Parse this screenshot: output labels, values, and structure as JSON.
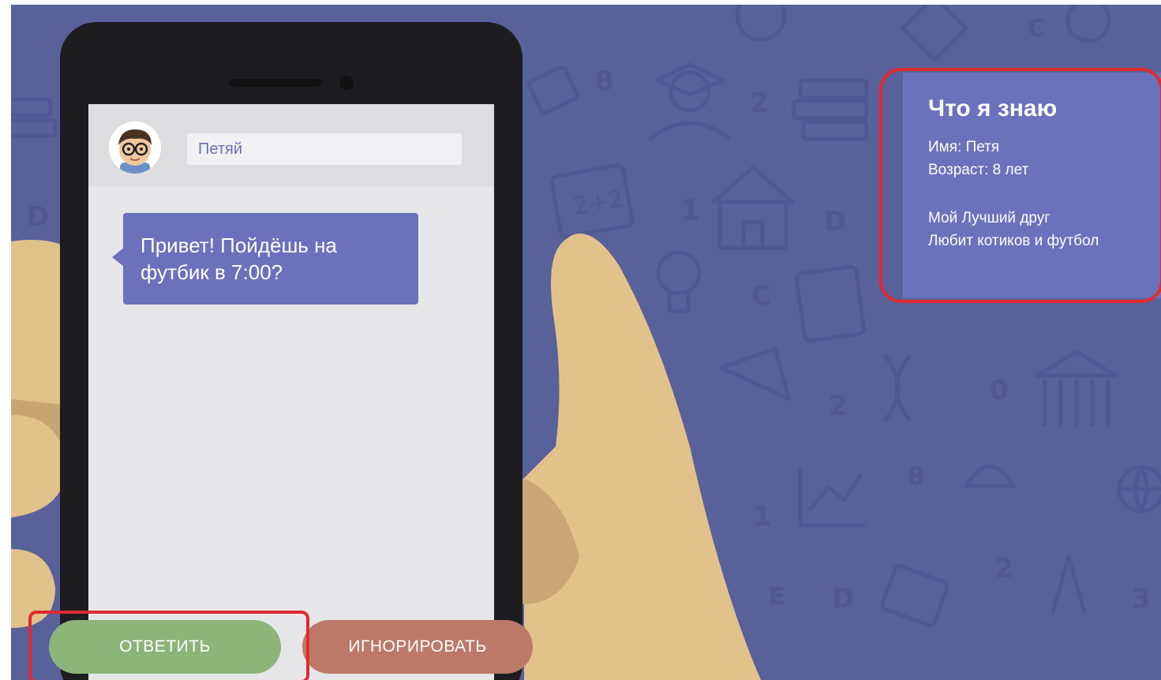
{
  "chat": {
    "contact_name": "Петяй",
    "message": "Привет! Пойдёшь на футбик в 7:00?"
  },
  "actions": {
    "reply_label": "ОТВЕТИТЬ",
    "ignore_label": "ИГНОРИРОВАТЬ"
  },
  "info_panel": {
    "title": "Что я знаю",
    "lines": [
      "Имя: Петя",
      "Возраст: 8 лет",
      "Мой Лучший друг",
      "Любит котиков и футбол"
    ]
  },
  "icons": [
    "boy-avatar-icon"
  ],
  "colors": {
    "background": "#59619a",
    "accent_purple": "#6b71bb",
    "reply_green": "#8db57a",
    "ignore_red": "#bd7968",
    "highlight_red": "#e02a2f"
  }
}
